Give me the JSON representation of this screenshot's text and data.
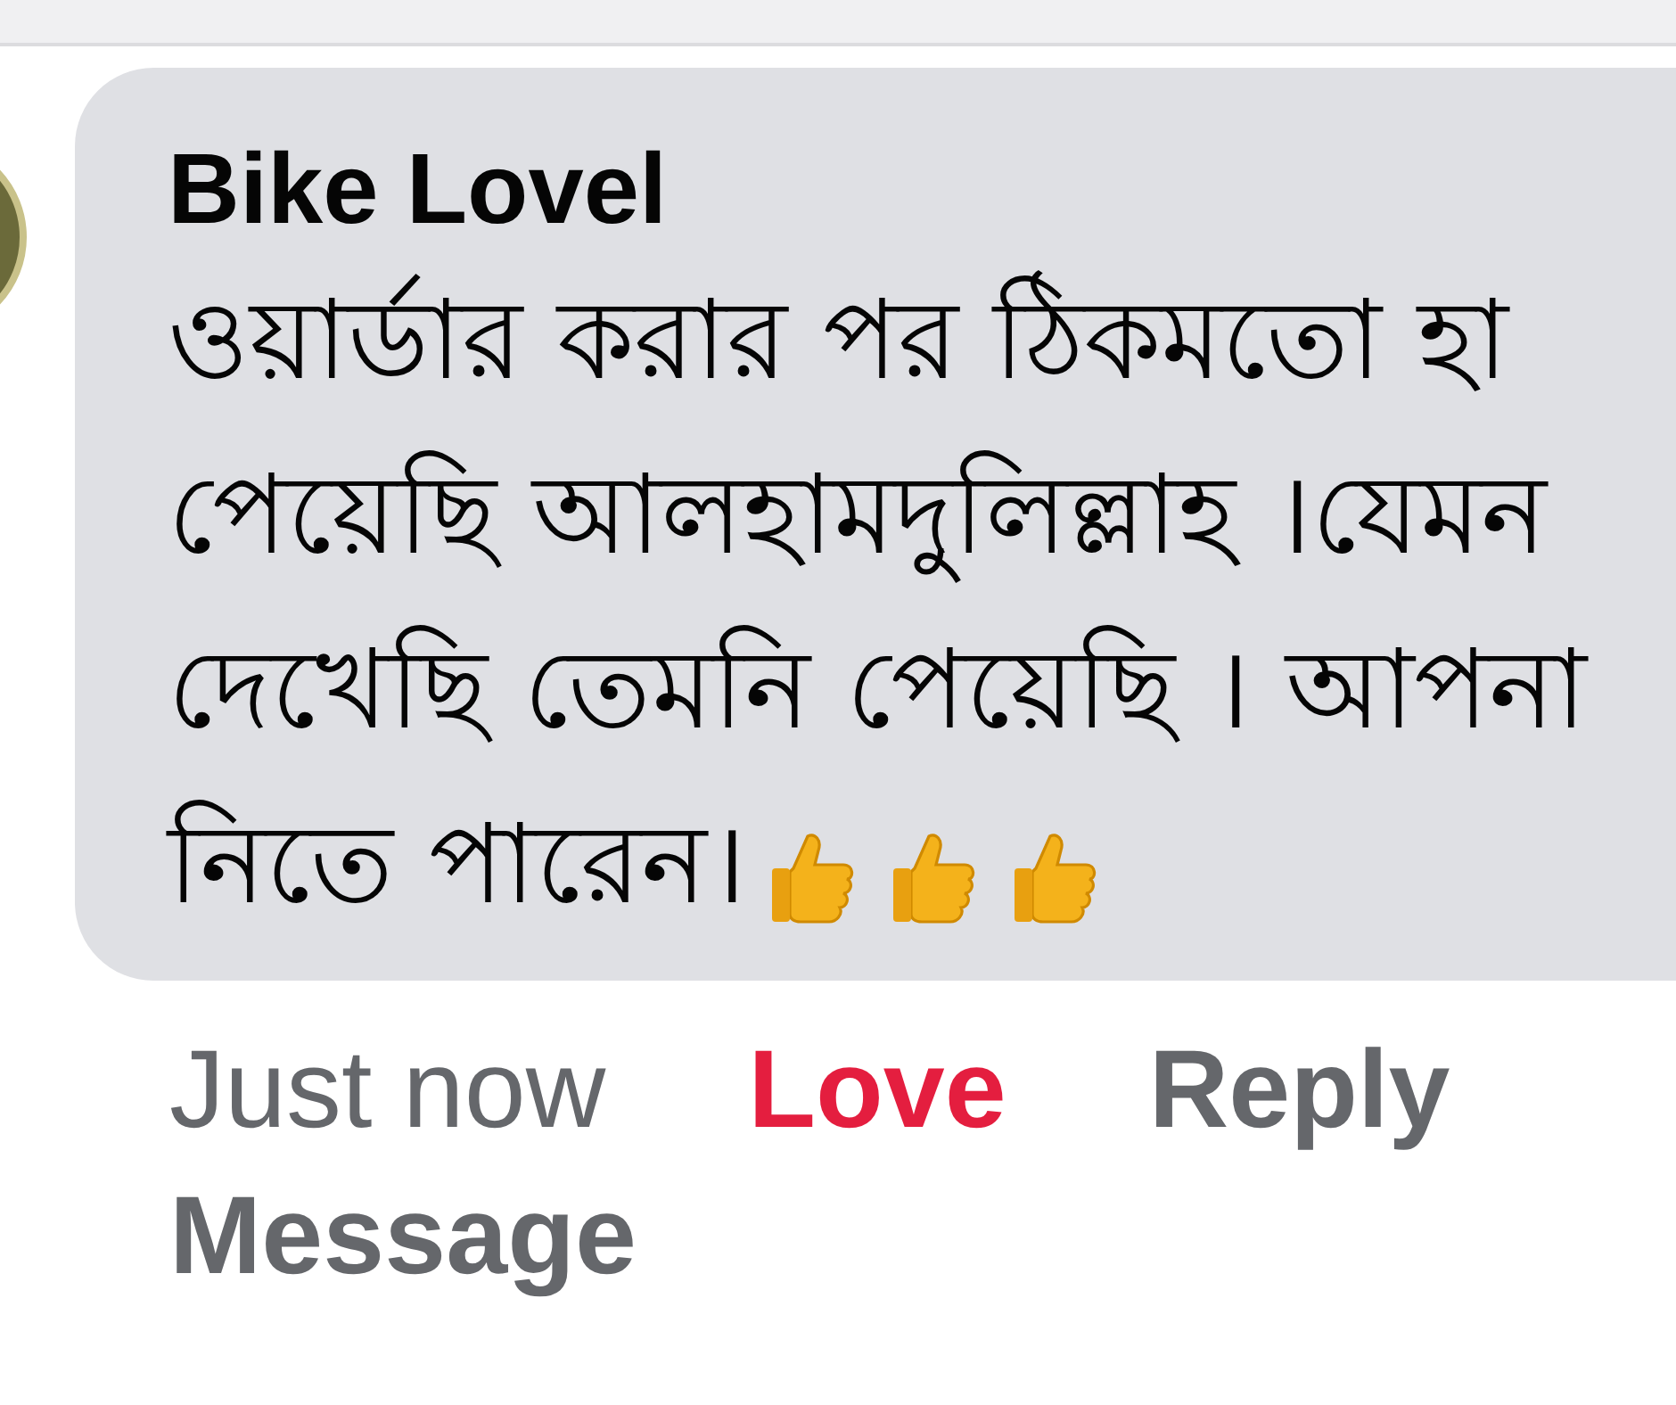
{
  "comment": {
    "author": "Bike Lovel",
    "lines": [
      "ওয়ার্ডার করার পর ঠিকমতো হা",
      "পেয়েছি আলহামদুলিল্লাহ ।যেমন",
      "দেখেছি তেমনি পেয়েছি । আপনা",
      "নিতে পারেন।"
    ],
    "emojis": [
      {
        "kind": "thumbs_up"
      },
      {
        "kind": "thumbs_up"
      },
      {
        "kind": "thumbs_up"
      }
    ]
  },
  "actions": [
    {
      "kind": "time",
      "label": "Just now"
    },
    {
      "kind": "reaction",
      "label": "Love",
      "reacted": true
    },
    {
      "kind": "action",
      "label": "Reply"
    },
    {
      "kind": "action",
      "label": "Message"
    }
  ]
}
